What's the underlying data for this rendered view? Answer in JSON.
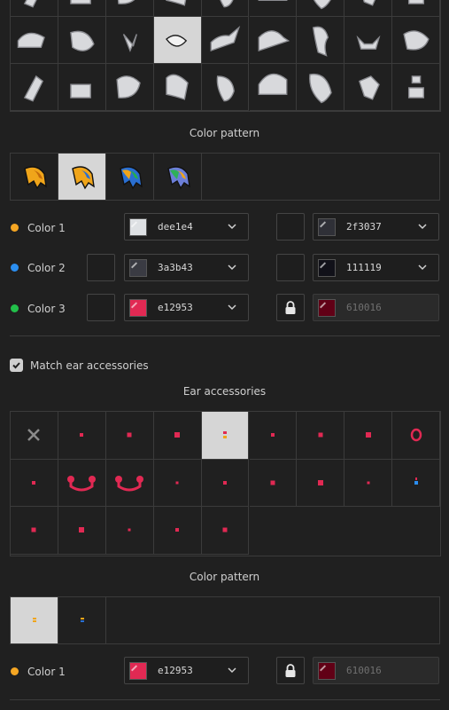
{
  "hair_grid": {
    "selected_index": 3
  },
  "pattern1": {
    "title": "Color pattern",
    "selected_index": 1,
    "swatches": [
      {
        "colors": [
          "#f0a51a",
          "#c46a0a"
        ]
      },
      {
        "colors": [
          "#f0a51a",
          "#2a6fd1"
        ]
      },
      {
        "colors": [
          "#2a6fd1",
          "#23b04a",
          "#f0a51a"
        ]
      },
      {
        "colors": [
          "#6c7fd8",
          "#f0a51a",
          "#2fb05a"
        ]
      }
    ]
  },
  "colors1": [
    {
      "label": "Color 1",
      "dot": "#f5a623",
      "left": {
        "hex": "dee1e4",
        "color": "#dee1e4"
      },
      "right": {
        "hex": "2f3037",
        "color": "#2f3037"
      },
      "left_square": false,
      "right_square": "empty",
      "right_disabled": false
    },
    {
      "label": "Color 2",
      "dot": "#2b8ef0",
      "left": {
        "hex": "3a3b43",
        "color": "#3a3b43"
      },
      "right": {
        "hex": "111119",
        "color": "#111119"
      },
      "left_square": true,
      "right_square": "empty",
      "right_disabled": false
    },
    {
      "label": "Color 3",
      "dot": "#22c04a",
      "left": {
        "hex": "e12953",
        "color": "#e12953"
      },
      "right": {
        "hex": "610016",
        "color": "#610016"
      },
      "left_square": true,
      "right_square": "lock",
      "right_disabled": true
    }
  ],
  "match_checkbox": {
    "label": "Match ear accessories",
    "checked": true
  },
  "ear_section": {
    "title": "Ear accessories",
    "selected_index": 4,
    "accent": "#e12953"
  },
  "pattern2": {
    "title": "Color pattern",
    "selected_index": 0
  },
  "colors2": [
    {
      "label": "Color 1",
      "dot": "#f5a623",
      "left": {
        "hex": "e12953",
        "color": "#e12953"
      },
      "right": {
        "hex": "610016",
        "color": "#610016"
      },
      "right_disabled": true
    }
  ]
}
